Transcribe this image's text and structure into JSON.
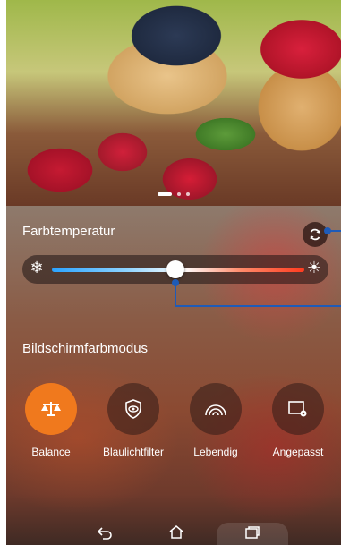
{
  "photo": {
    "pager_dots": 3,
    "active_index": 0
  },
  "color_temperature": {
    "title": "Farbtemperatur",
    "slider_value_fraction": 0.48,
    "cold_icon": "snowflake-icon",
    "warm_icon": "sun-icon",
    "reset_icon": "reset-icon"
  },
  "screen_color_mode": {
    "title": "Bildschirmfarbmodus",
    "modes": [
      {
        "label": "Balance",
        "icon": "balance-scale-icon",
        "active": true
      },
      {
        "label": "Blaulichtfilter",
        "icon": "eye-shield-icon",
        "active": false
      },
      {
        "label": "Lebendig",
        "icon": "rainbow-icon",
        "active": false
      },
      {
        "label": "Angepasst",
        "icon": "custom-settings-icon",
        "active": false
      }
    ]
  },
  "navigation": {
    "back_icon": "back-icon",
    "home_icon": "home-icon",
    "recents_icon": "recents-icon"
  },
  "colors": {
    "accent": "#f0791d",
    "callout": "#1e5bb8"
  }
}
